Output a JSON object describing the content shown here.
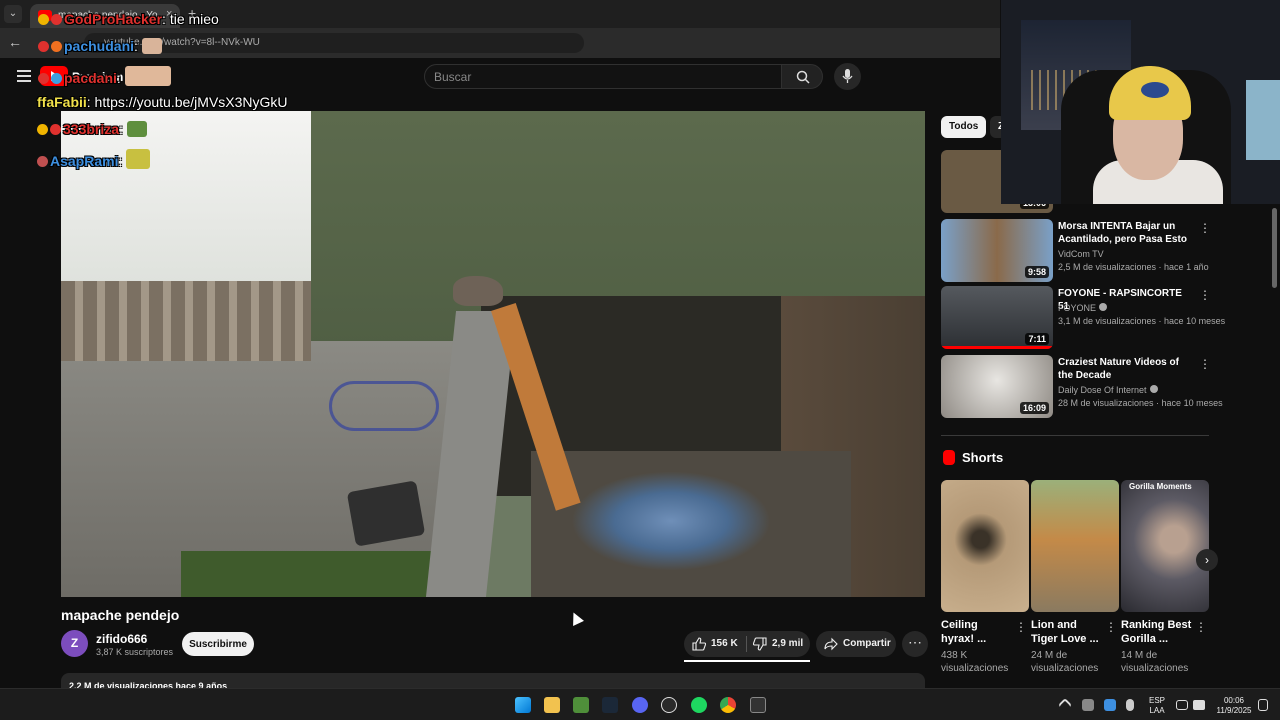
{
  "browser": {
    "tab_title": "mapache pendejo - YouTube",
    "tab_close": "×",
    "tab_new": "+",
    "back": "←",
    "url": "youtube.com/watch?v=8l--NVk-WU"
  },
  "header": {
    "logo_text": "Premium",
    "search_placeholder": "Buscar"
  },
  "chat": [
    {
      "user": "GodProHacker",
      "msg": ": tie mieo",
      "color": "#e0312e"
    },
    {
      "user": "pachudani",
      "msg": ":",
      "color": "#3d8fe0"
    },
    {
      "user": "pacdani",
      "msg": ":",
      "color": "#e0312e"
    },
    {
      "user": "ffaFabii",
      "msg": ": https://youtu.be/jMVsX3NyGkU",
      "color": "#f0e04a"
    },
    {
      "user": "333briza",
      "msg": ":",
      "color": "#e0312e"
    },
    {
      "user": "AsapRami",
      "msg": ":",
      "color": "#3d8fe0"
    }
  ],
  "video": {
    "title": "mapache pendejo",
    "channel_initial": "Z",
    "channel": "zifido666",
    "subscribers": "3,87 K suscriptores",
    "subscribe_label": "Suscribirme",
    "likes": "156 K",
    "dislikes": "2,9 mil",
    "share_label": "Compartir",
    "more": "⋯",
    "description": "2,2 M de visualizaciones  hace 9 años"
  },
  "sidebar": {
    "chips": [
      "Todos",
      "Z"
    ],
    "recommendations": [
      {
        "title": "",
        "channel": "",
        "meta": "",
        "duration": "13:06",
        "thumb": "#6a5a44"
      },
      {
        "title": "Morsa INTENTA Bajar un Acantilado, pero Pasa Esto",
        "channel": "VidCom TV",
        "meta": "2,5 M de visualizaciones · hace 1 año",
        "duration": "9:58",
        "thumb": "#7aa0c8"
      },
      {
        "title": "FOYONE - RAPSINCORTE 51",
        "channel": "FOYONE",
        "meta": "3,1 M de visualizaciones · hace 10 meses",
        "duration": "7:11",
        "thumb": "#3a3f44"
      },
      {
        "title": "Craziest Nature Videos of the Decade",
        "channel": "Daily Dose Of Internet",
        "meta": "28 M de visualizaciones · hace 10 meses",
        "duration": "16:09",
        "thumb": "#a7a39c"
      }
    ],
    "shorts_heading": "Shorts",
    "shorts": [
      {
        "title": "Ceiling hyrax! ...",
        "views": "438 K visualizaciones",
        "thumb": "#b59a78"
      },
      {
        "title": "Lion and Tiger Love ...",
        "views": "24 M de visualizaciones",
        "thumb": "#c48a48"
      },
      {
        "title": "Ranking Best Gorilla ...",
        "views": "14 M de visualizaciones",
        "thumb": "#5c5a64",
        "overlay": "Gorilla Moments"
      }
    ],
    "shorts_next": "›"
  },
  "taskbar": {
    "language_line1": "ESP",
    "language_line2": "LAA",
    "time": "00:06",
    "date": "11/9/2025"
  }
}
